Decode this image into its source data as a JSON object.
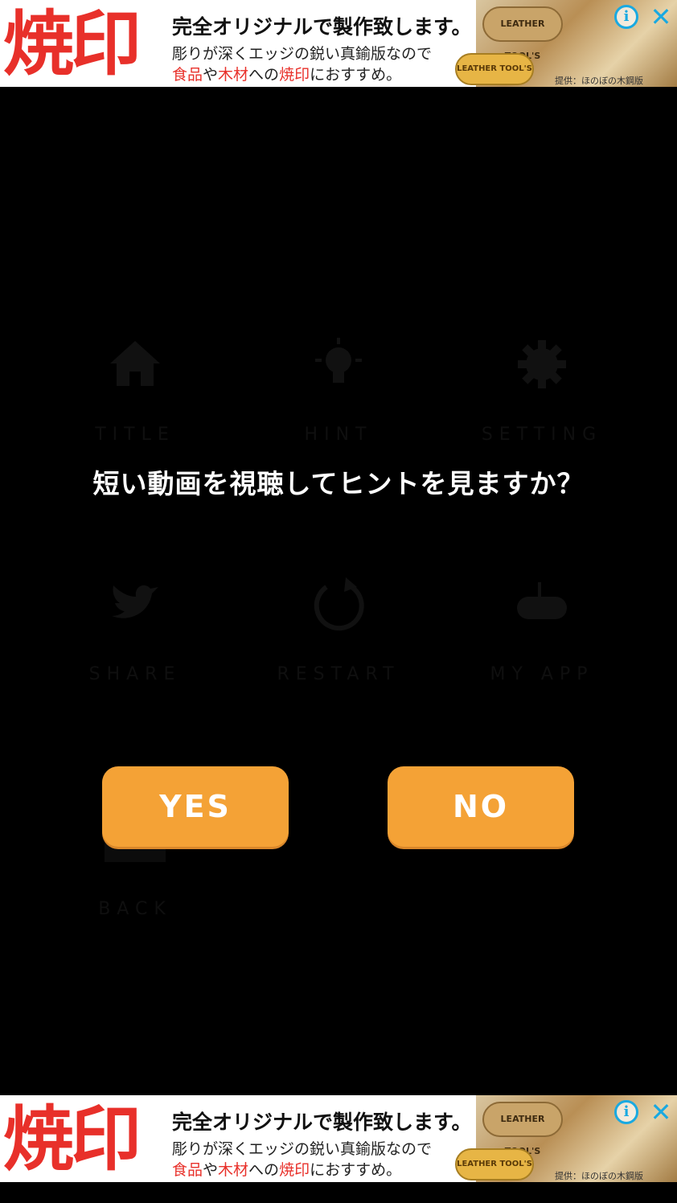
{
  "ad_top": {
    "big_text": "焼印",
    "headline": "完全オリジナルで製作致します。",
    "line2": "彫りが深くエッジの鋭い真鍮版なので",
    "line3_parts": [
      "食品",
      "や",
      "木材",
      "への",
      "焼印",
      "におすすめ。"
    ],
    "stamp1": "LEATHER TOOL'S",
    "stamp2": "LEATHER TOOL'S",
    "credit": "提供：ほのぼの木鋼版",
    "info_icon": "i",
    "close_icon": "✕"
  },
  "ad_bottom": {
    "big_text": "焼印",
    "headline": "完全オリジナルで製作致します。",
    "line2": "彫りが深くエッジの鋭い真鍮版なので",
    "line3_parts": [
      "食品",
      "や",
      "木材",
      "への",
      "焼印",
      "におすすめ。"
    ],
    "stamp1": "LEATHER TOOL'S",
    "stamp2": "LEATHER TOOL'S",
    "credit": "提供：ほのぼの木鋼版",
    "info_icon": "i",
    "close_icon": "✕"
  },
  "menu": {
    "items": [
      {
        "label": "TITLE",
        "icon": "home-icon"
      },
      {
        "label": "HINT",
        "icon": "lightbulb-icon"
      },
      {
        "label": "SETTING",
        "icon": "gear-icon"
      },
      {
        "label": "SHARE",
        "icon": "twitter-icon"
      },
      {
        "label": "RESTART",
        "icon": "restart-icon"
      },
      {
        "label": "MY APP",
        "icon": "gamepad-icon"
      },
      {
        "label": "BACK",
        "icon": "back-icon"
      }
    ]
  },
  "dialog": {
    "message": "短い動画を視聴してヒントを見ますか？",
    "yes_label": "YES",
    "no_label": "NO"
  },
  "colors": {
    "background": "#000000",
    "button": "#f4a236",
    "ad_red": "#e8302a",
    "ad_blue": "#19a9e1"
  }
}
